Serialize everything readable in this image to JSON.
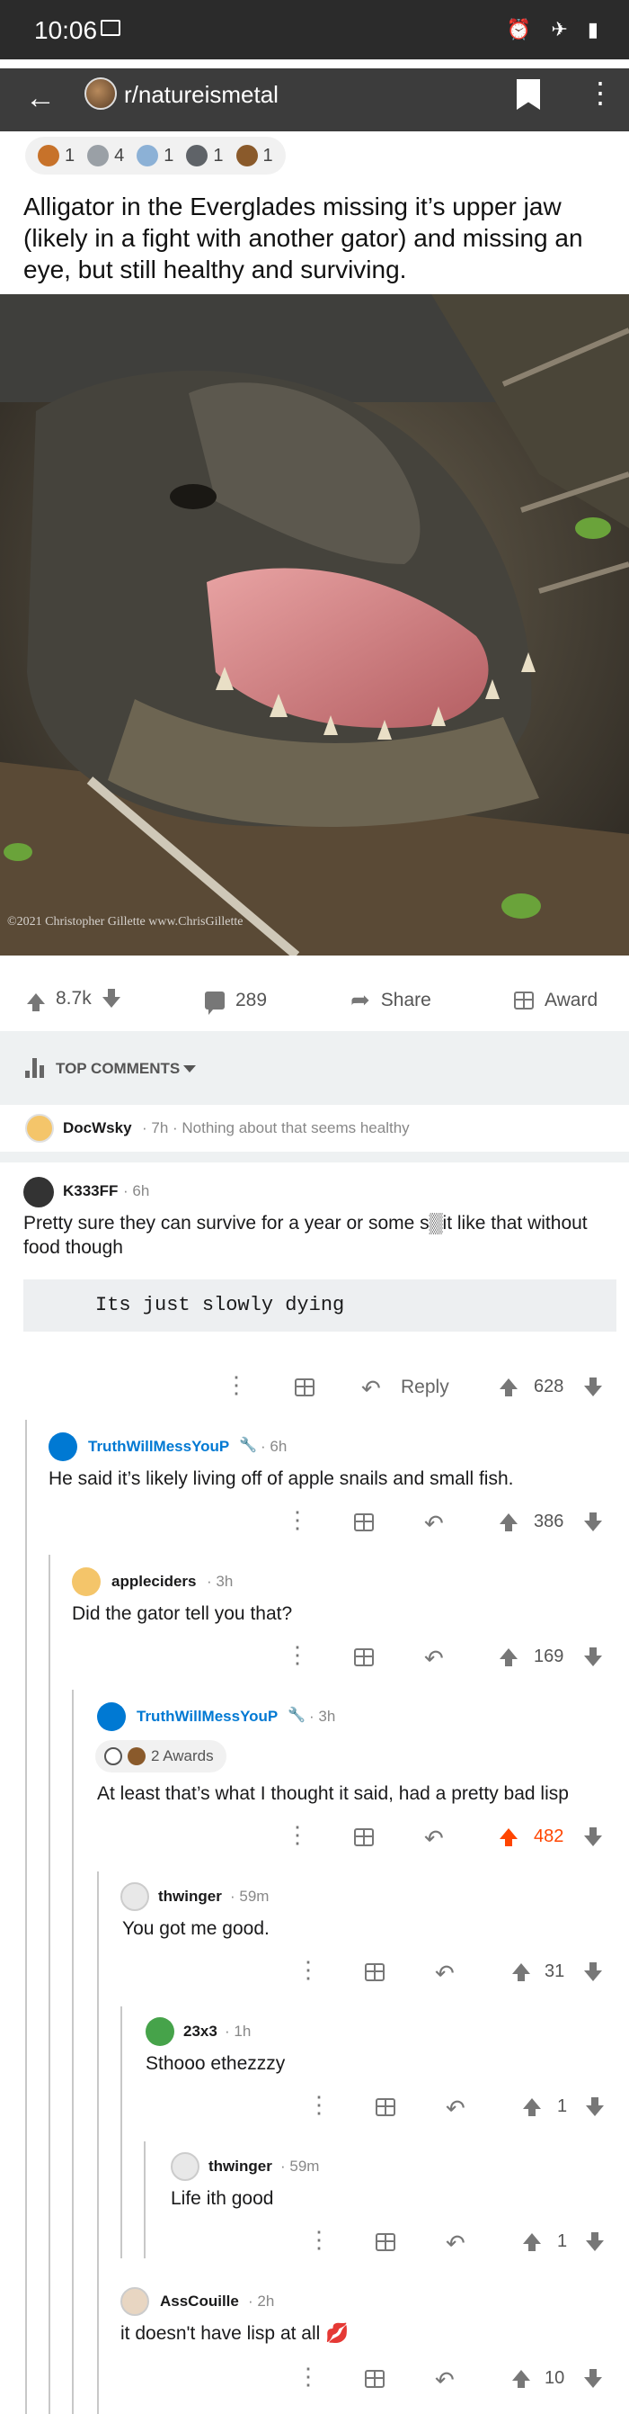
{
  "status_bar": {
    "time": "10:06"
  },
  "app_bar": {
    "subreddit": "r/natureismetal"
  },
  "post": {
    "awards": [
      {
        "name": "award-1",
        "count": "1",
        "color": "#c7722a"
      },
      {
        "name": "award-2",
        "count": "4",
        "color": "#9aa0a6"
      },
      {
        "name": "award-3",
        "count": "1",
        "color": "#8cb1d6"
      },
      {
        "name": "award-4",
        "count": "1",
        "color": "#5f6368"
      },
      {
        "name": "award-5",
        "count": "1",
        "color": "#8a5a2b"
      }
    ],
    "title": "Alligator in the Everglades missing it’s upper jaw (likely in a fight with another gator) and missing an eye, but still healthy and surviving.",
    "image_credit": "©2021 Christopher Gillette  www.ChrisGillette",
    "score": "8.7k",
    "comments_count": "289",
    "share_label": "Share",
    "award_label": "Award"
  },
  "comments_header": {
    "sort_label": "TOP COMMENTS"
  },
  "collapsed_comment": {
    "author": "DocWsky",
    "meta": "· 7h · Nothing about that seems healthy"
  },
  "comments": [
    {
      "author": "K333FF",
      "time": "· 6h",
      "body": "Pretty sure they can survive for a year or some s▒it like that without food though",
      "code": "Its just slowly dying",
      "reply_label": "Reply",
      "score": "628"
    },
    {
      "author": "TruthWillMessYouP",
      "time": "· 6h",
      "body": "He said it’s likely living off of apple snails and small fish.",
      "score": "386"
    },
    {
      "author": "appleciders",
      "time": "· 3h",
      "body": "Did the gator tell you that?",
      "score": "169"
    },
    {
      "author": "TruthWillMessYouP",
      "time": "· 3h",
      "awards_label": "2 Awards",
      "body": "At least that’s what I thought it said, had a pretty  bad lisp",
      "score": "482"
    },
    {
      "author": "thwinger",
      "time": "· 59m",
      "body": "You got me good.",
      "score": "31"
    },
    {
      "author": "23x3",
      "time": "· 1h",
      "body": "Sthooo ethezzzy",
      "score": "1"
    },
    {
      "author": "thwinger",
      "time": "· 59m",
      "body": "Life ith good",
      "score": "1"
    },
    {
      "author": "AssCouille",
      "time": "· 2h",
      "body": "it doesn't have lisp at all 💋",
      "score": "10"
    }
  ],
  "colors": {
    "accent_blue": "#0079d3",
    "upvote_orange": "#ff4500"
  }
}
